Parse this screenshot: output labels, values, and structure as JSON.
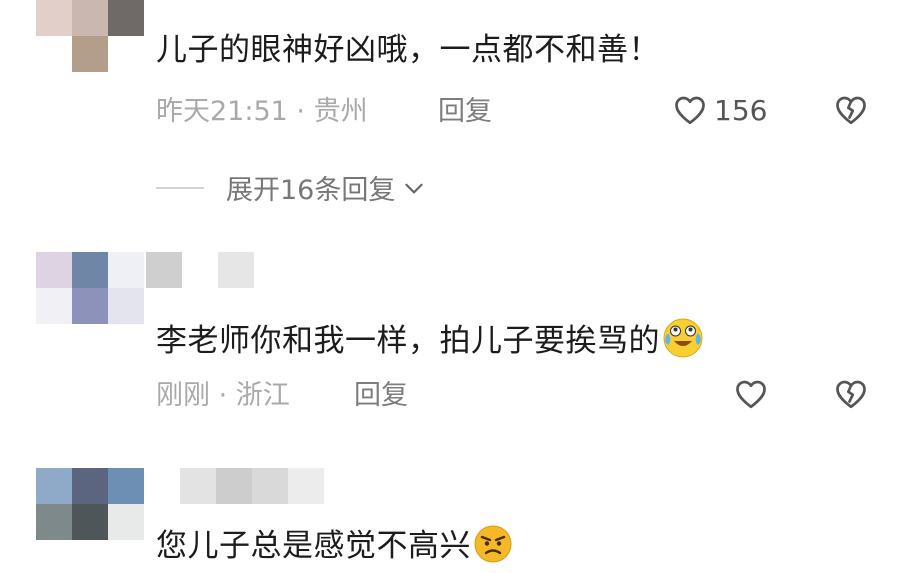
{
  "comments": [
    {
      "text": "儿子的眼神好凶哦，一点都不和善！",
      "time": "昨天21:51",
      "separator": "·",
      "location": "贵州",
      "reply_label": "回复",
      "likes": "156",
      "expand_label": "展开16条回复"
    },
    {
      "text": "李老师你和我一样，拍儿子要挨骂的",
      "emoji": "laugh-cry-emoji",
      "time": "刚刚",
      "separator": "·",
      "location": "浙江",
      "reply_label": "回复"
    },
    {
      "text": "您儿子总是感觉不高兴",
      "emoji": "angry-emoji"
    }
  ],
  "icons": {
    "like": "heart-outline-icon",
    "dislike": "broken-heart-icon",
    "expand": "chevron-down-icon"
  },
  "colors": {
    "text": "#1c1c1c",
    "meta": "#a9a9a9",
    "reply": "#7d7d7d",
    "icon": "#555555"
  }
}
